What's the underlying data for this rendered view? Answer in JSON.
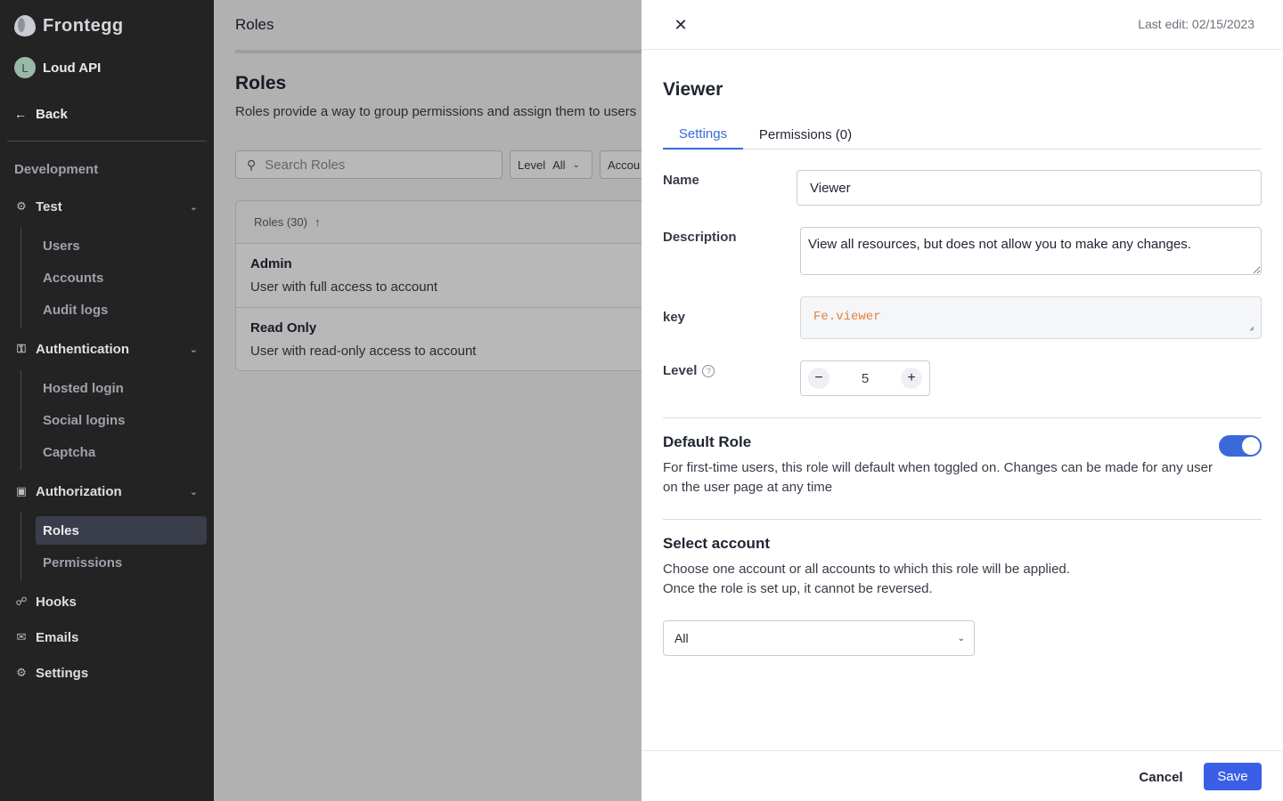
{
  "sidebar": {
    "brand": "Frontegg",
    "environment": {
      "initial": "L",
      "name": "Loud API"
    },
    "back_label": "Back",
    "section_label": "Development",
    "groups": [
      {
        "label": "Test",
        "icon": "bug-icon",
        "items": [
          "Users",
          "Accounts",
          "Audit logs"
        ]
      },
      {
        "label": "Authentication",
        "icon": "key-icon",
        "items": [
          "Hosted login",
          "Social logins",
          "Captcha"
        ]
      },
      {
        "label": "Authorization",
        "icon": "lock-icon",
        "items": [
          "Roles",
          "Permissions"
        ],
        "active_item": "Roles"
      },
      {
        "label": "Hooks",
        "icon": "hooks-icon"
      },
      {
        "label": "Emails",
        "icon": "mail-icon"
      },
      {
        "label": "Settings",
        "icon": "gear-icon"
      }
    ]
  },
  "main": {
    "breadcrumb": "Roles",
    "title": "Roles",
    "description": "Roles provide a way to group permissions and assign them to users",
    "search": {
      "placeholder": "Search Roles"
    },
    "filters": [
      {
        "label": "Level",
        "value": "All"
      },
      {
        "label": "Accou"
      }
    ],
    "table": {
      "header": "Roles (30)",
      "rows": [
        {
          "name": "Admin",
          "description": "User with full access to account"
        },
        {
          "name": "Read Only",
          "description": "User with read-only access to account"
        }
      ]
    }
  },
  "drawer": {
    "last_edit": "Last edit: 02/15/2023",
    "title": "Viewer",
    "tabs": [
      {
        "label": "Settings",
        "active": true
      },
      {
        "label": "Permissions (0)",
        "active": false
      }
    ],
    "fields": {
      "name_label": "Name",
      "name_value": "Viewer",
      "description_label": "Description",
      "description_value": "View all resources, but does not allow you to make any changes.",
      "key_label": "key",
      "key_value": "Fe.viewer",
      "level_label": "Level",
      "level_value": "5"
    },
    "default_role": {
      "title": "Default Role",
      "text_line1": "For first-time users, this role will default when toggled on. Changes can be made for any user",
      "text_line2": "on the user page at any time",
      "enabled": true
    },
    "select_account": {
      "title": "Select account",
      "text_line1": "Choose one account or all accounts to which this role will be applied.",
      "text_line2": "Once the role is set up, it cannot be reversed.",
      "selected": "All"
    },
    "footer": {
      "cancel_label": "Cancel",
      "save_label": "Save"
    }
  },
  "colors": {
    "accent": "#3a6ad8",
    "save_button": "#3a5fe6",
    "key_text": "#e0833b",
    "sidebar_bg": "#232323"
  }
}
